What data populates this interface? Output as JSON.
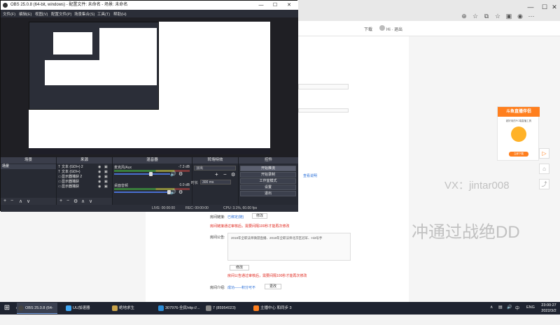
{
  "obs": {
    "title": "OBS 25.0.8 (64-bit, windows) - 配置文件: 未命名 - 场景: 未命名",
    "menu": [
      "文件(F)",
      "编辑(E)",
      "视图(V)",
      "配置文件(P)",
      "场景集合(S)",
      "工具(T)",
      "帮助(H)"
    ],
    "docks": {
      "scenes": "场景",
      "sources": "来源",
      "mixer": "混音器",
      "transitions": "转场特效",
      "controls": "控件"
    },
    "scenes": [
      "场景"
    ],
    "sources": [
      "文本 (GDI+) 2",
      "文本 (GDI+)",
      "显示器捕获 2",
      "显示器捕获",
      "显示器捕获"
    ],
    "mixer": [
      {
        "name": "麦克风/Aux",
        "db": "-7.3 dB"
      },
      {
        "name": "桌面音频",
        "db": "0.0 dB"
      }
    ],
    "transition": {
      "label": "淡出",
      "duration_label": "时长",
      "duration": "300 ms"
    },
    "controls": [
      "开始推流",
      "开始录制",
      "工作室模式",
      "设置",
      "退出"
    ],
    "status": {
      "live": "LIVE: 00:00:00",
      "rec": "REC: 00:00:00",
      "cpu": "CPU: 3.1%, 60.00 fps"
    }
  },
  "browser": {
    "header": {
      "download": "下载",
      "user": "Hi · 退出"
    },
    "form": {
      "label_link": "房间链接:",
      "link_text": "已绑定(链)",
      "link_btn": "修改",
      "err1": "房间链接通过审核后，需要间隔100秒才能再次修改",
      "label_notice": "房间公告:",
      "notice_text": "2018年全职法师微游直播、2018年全职法师北京区冠军、Hi3号手",
      "notice_btn": "修改",
      "err2": "房间公告通过审核后，需要间隔100秒才能再次修改",
      "label_intro": "房间介绍:",
      "intro_link": "成功——积分可不",
      "intro_btn": "更改",
      "blue_link": "查看说明"
    },
    "promo": {
      "title": "斗鱼直播伴侣",
      "sub": "超好用的PC端直播工具",
      "button": "立即下载"
    },
    "watermarks": [
      "VX：jintar008",
      "冲通过战绝DD"
    ]
  },
  "taskbar": {
    "apps": [
      "OBS 25.0.8 (64-bit...",
      "UU加速器",
      "绝地求生",
      "307976-全民http://...",
      "7 (85954023)",
      "主播中心 和同步 3 ..."
    ],
    "tray_lang": "ENG",
    "time": "23:00:27",
    "date": "2022/3/2"
  }
}
